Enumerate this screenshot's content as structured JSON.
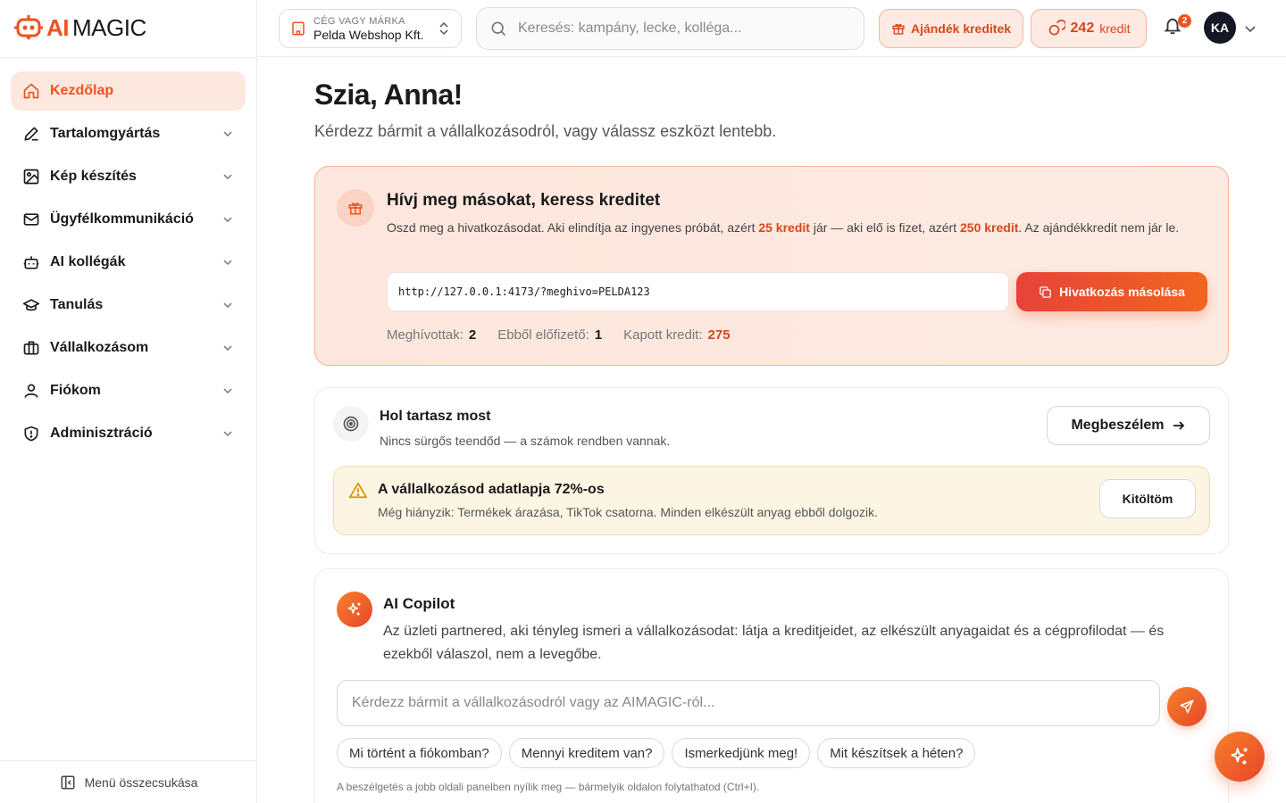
{
  "logo": {
    "ai": "AI",
    "magic": "MAGIC"
  },
  "sidebar": {
    "items": [
      {
        "label": "Kezdőlap",
        "icon": "home-icon",
        "active": true
      },
      {
        "label": "Tartalomgyártás",
        "icon": "pen-icon"
      },
      {
        "label": "Kép készítés",
        "icon": "image-icon"
      },
      {
        "label": "Ügyfélkommunikáció",
        "icon": "mail-icon"
      },
      {
        "label": "AI kollégák",
        "icon": "bot-icon"
      },
      {
        "label": "Tanulás",
        "icon": "graduation-cap-icon"
      },
      {
        "label": "Vállalkozásom",
        "icon": "briefcase-icon"
      },
      {
        "label": "Fiókom",
        "icon": "user-icon"
      },
      {
        "label": "Adminisztráció",
        "icon": "shield-icon"
      }
    ],
    "collapse_label": "Menü összecsukása"
  },
  "header": {
    "brand_caption": "CÉG VAGY MÁRKA",
    "brand_value": "Pelda Webshop Kft.",
    "search_placeholder": "Keresés: kampány, lecke, kolléga...",
    "gift_label": "Ajándék kreditek",
    "credit_amount": "242",
    "credit_label": "kredit",
    "notification_count": "2",
    "avatar_initials": "KA"
  },
  "main": {
    "greeting": "Szia, Anna!",
    "subtitle": "Kérdezz bármit a vállalkozásodról, vagy válassz eszközt lentebb."
  },
  "invite": {
    "title": "Hívj meg másokat, keress kreditet",
    "desc_1": "Oszd meg a hivatkozásodat. Aki elindítja az ingyenes próbát, azért ",
    "desc_bold_1": "25 kredit",
    "desc_2": " jár — aki elő is fizet, azért ",
    "desc_bold_2": "250 kredit",
    "desc_3": ". Az ajándékkredit nem jár le.",
    "link": "http://127.0.0.1:4173/?meghivo=PELDA123",
    "copy_label": "Hivatkozás másolása",
    "stats": {
      "invited_label": "Meghívottak:",
      "invited_value": "2",
      "subscribers_label": "Ebből előfizető:",
      "subscribers_value": "1",
      "credit_label": "Kapott kredit:",
      "credit_value": "275"
    }
  },
  "status": {
    "title": "Hol tartasz most",
    "desc": "Nincs sürgős teendőd — a számok rendben vannak.",
    "button_label": "Megbeszélem",
    "warning": {
      "title": "A vállalkozásod adatlapja 72%-os",
      "desc": "Még hiányzik: Termékek árazása, TikTok csatorna. Minden elkészült anyag ebből dolgozik.",
      "button_label": "Kitöltöm"
    }
  },
  "copilot": {
    "title": "AI Copilot",
    "desc": "Az üzleti partnered, aki tényleg ismeri a vállalkozásodat: látja a kreditjeidet, az elkészült anyagaidat és a cégprofilodat — és ezekből válaszol, nem a levegőbe.",
    "input_placeholder": "Kérdezz bármit a vállalkozásodról vagy az AIMAGIC-ról...",
    "chips": [
      "Mi történt a fiókomban?",
      "Mennyi kreditem van?",
      "Ismerkedjünk meg!",
      "Mit készítsek a héten?"
    ],
    "hint": "A beszélgetés a jobb oldali panelben nyílik meg — bármelyik oldalon folytathatod (Ctrl+I)."
  },
  "colors": {
    "accent": "#f0521f",
    "accent_dark": "#d9461a",
    "warning_bg": "#fdf5e4"
  }
}
